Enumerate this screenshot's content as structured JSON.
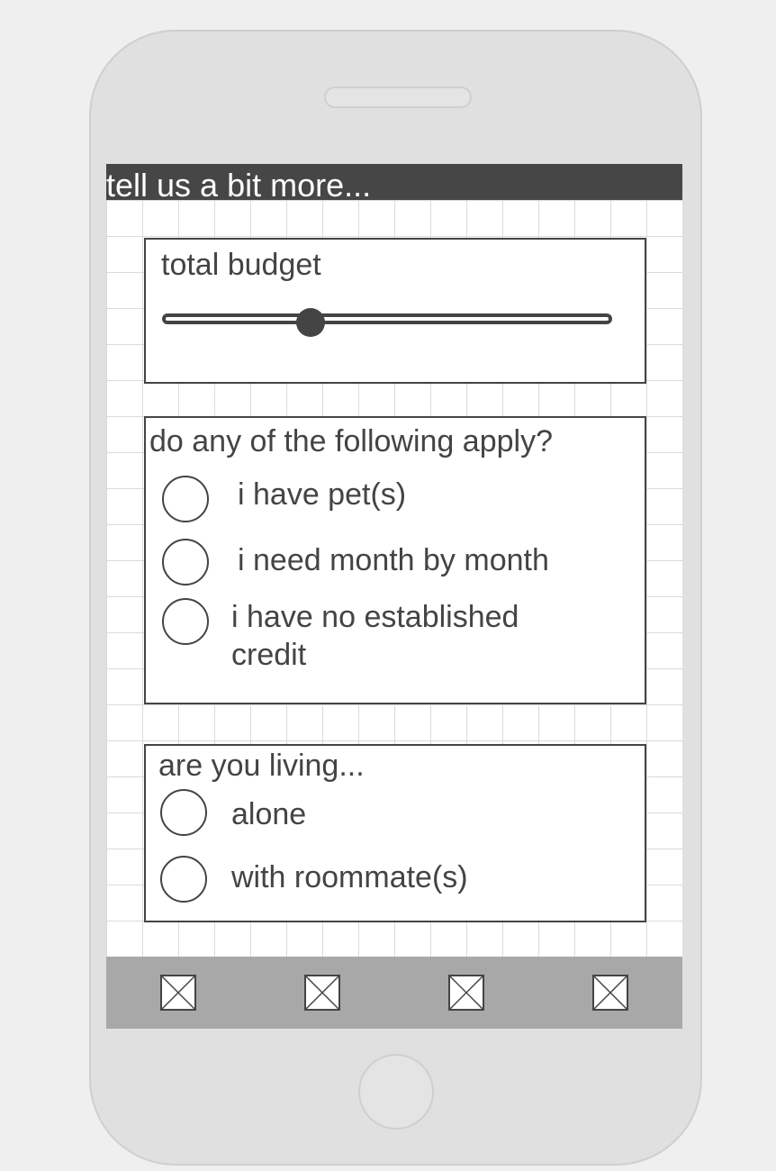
{
  "header": {
    "title": "tell us a bit more..."
  },
  "budget": {
    "title": "total budget",
    "slider_fraction": 0.33
  },
  "apply": {
    "title": "do any of the following apply?",
    "options": [
      {
        "label": "i have pet(s)",
        "checked": false
      },
      {
        "label": "i need month by month",
        "checked": false
      },
      {
        "label": "i have no established credit",
        "checked": false
      }
    ]
  },
  "living": {
    "title": "are you living...",
    "options": [
      {
        "label": "alone",
        "checked": false
      },
      {
        "label": "with roommate(s)",
        "checked": false
      }
    ]
  },
  "tab_bar": {
    "items": [
      {
        "icon": "placeholder-image-icon"
      },
      {
        "icon": "placeholder-image-icon"
      },
      {
        "icon": "placeholder-image-icon"
      },
      {
        "icon": "placeholder-image-icon"
      }
    ]
  }
}
